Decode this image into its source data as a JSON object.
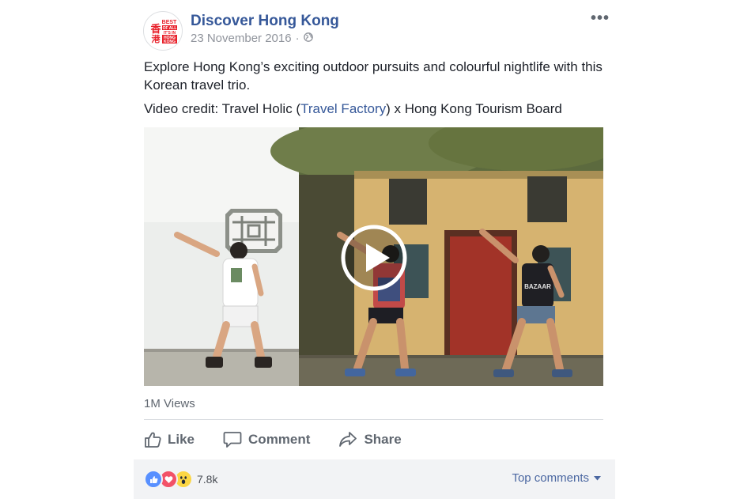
{
  "post": {
    "page_name": "Discover Hong Kong",
    "date": "23 November 2016",
    "separator": "·",
    "privacy_icon": "globe-icon",
    "more_label": "•••",
    "text": "Explore Hong Kong’s exciting outdoor pursuits and colourful nightlife with this Korean travel trio.",
    "credit_prefix": "Video credit: Travel Holic (",
    "credit_link": "Travel Factory",
    "credit_suffix": ") x Hong Kong Tourism Board",
    "logo": {
      "line1": "BEST",
      "line2": "OF ALL",
      "line3": "IT'S IN",
      "line4": "HONG",
      "line5": "KONG",
      "chinese": "香港"
    }
  },
  "video": {
    "play_icon": "play-icon",
    "views": "1M Views"
  },
  "actions": {
    "like": "Like",
    "comment": "Comment",
    "share": "Share"
  },
  "footer": {
    "reaction_icons": [
      "like-icon",
      "love-icon",
      "wow-icon"
    ],
    "reaction_count": "7.8k",
    "top_comments": "Top comments"
  },
  "colors": {
    "link": "#365899",
    "like_blue": "#5890ff",
    "love_red": "#f25268",
    "wow_yellow": "#fcd644",
    "logo_red": "#e8202a"
  }
}
